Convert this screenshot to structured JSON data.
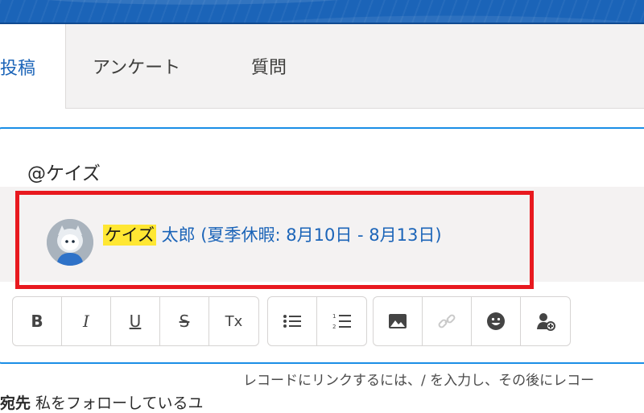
{
  "tabs": [
    {
      "label": "投稿",
      "active": true
    },
    {
      "label": "アンケート",
      "active": false
    },
    {
      "label": "質問",
      "active": false
    }
  ],
  "composer": {
    "mention_text": "@ケイズ"
  },
  "suggestion": {
    "highlight": "ケイズ",
    "rest": " 太郎 (夏季休暇: 8月10日 - 8月13日)"
  },
  "toolbar": {
    "bold": "B",
    "italic": "I",
    "underline": "U",
    "strike": "S",
    "clear_format": "Tx"
  },
  "helper_text": "レコードにリンクするには、/ を入力し、その後にレコー",
  "bottom_text": {
    "bold": "宛先",
    "rest": "  私をフォローしているユ"
  },
  "colors": {
    "brand": "#1b64b8",
    "focus_border": "#1b8ee6",
    "highlight": "#ffe733",
    "callout": "#e8191f"
  }
}
